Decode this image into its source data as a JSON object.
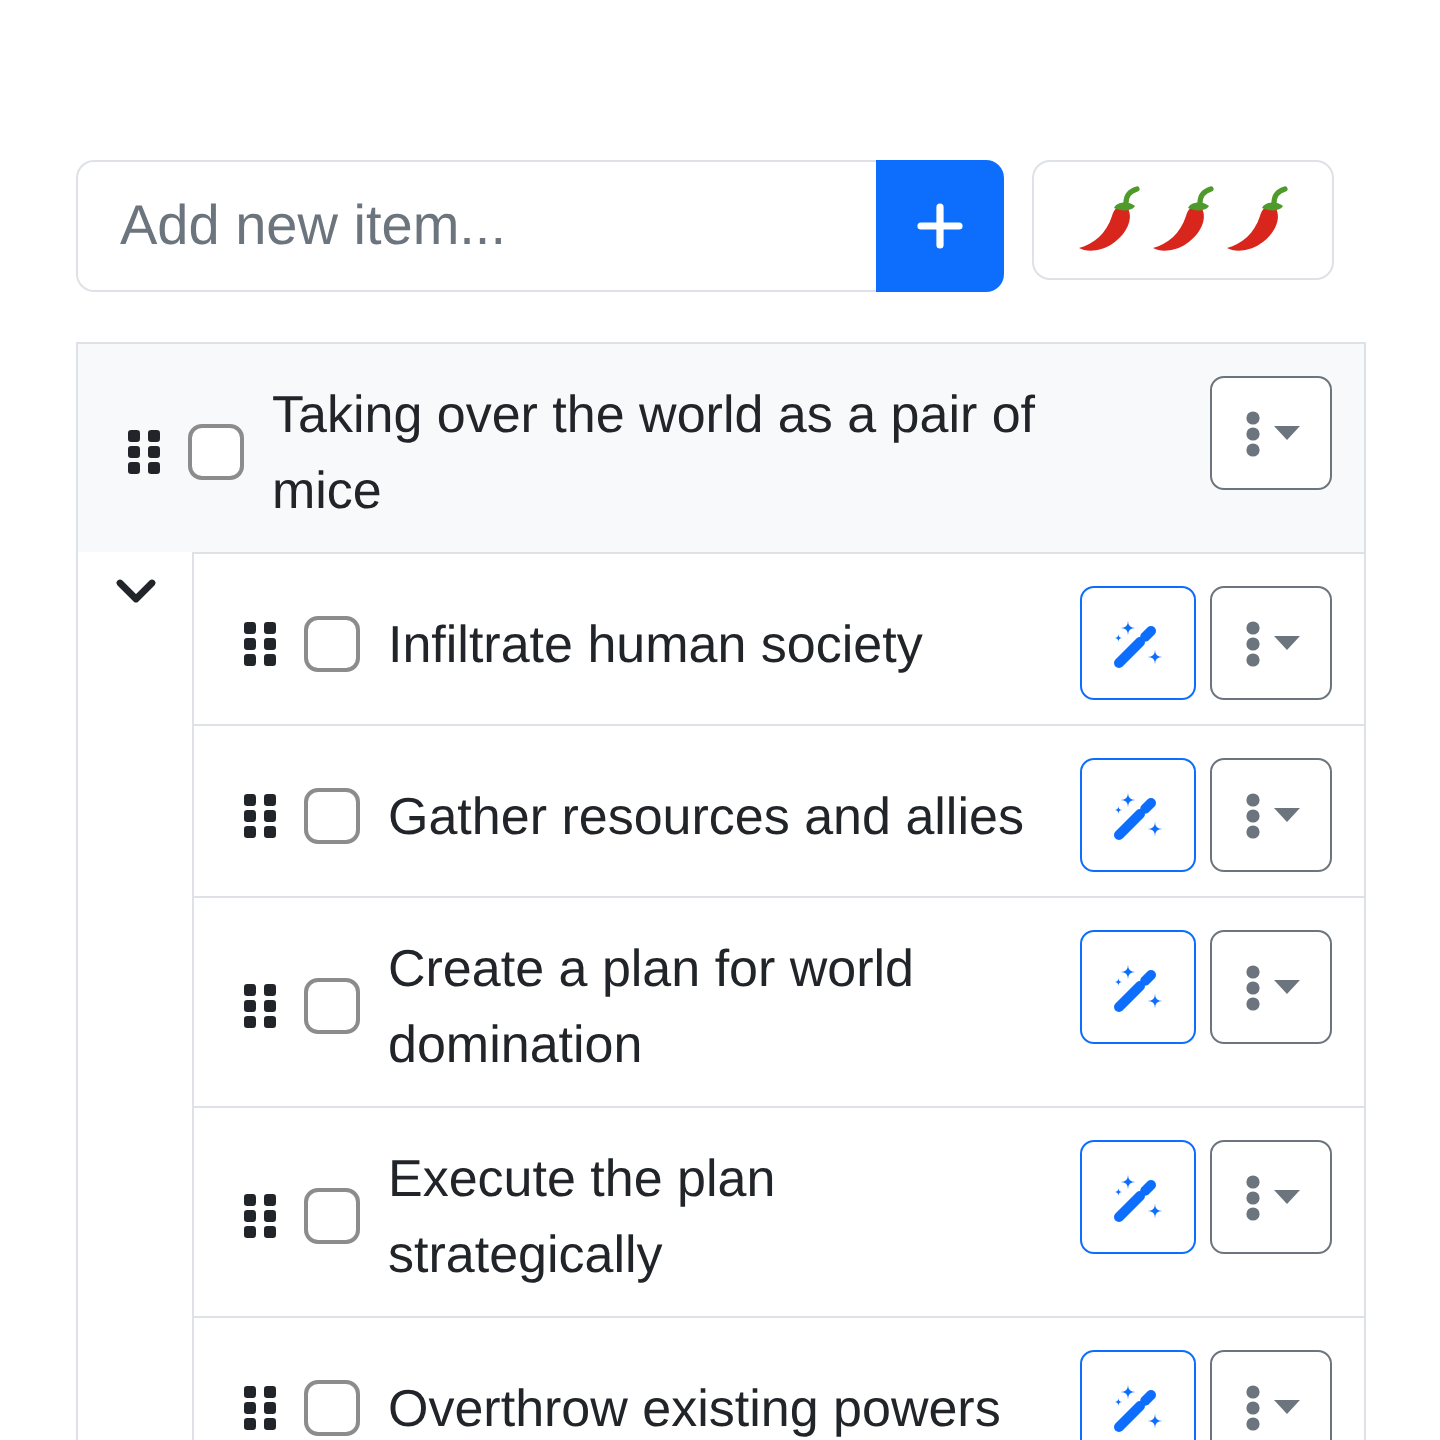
{
  "add_item": {
    "placeholder": "Add new item..."
  },
  "spice_button": {
    "icons": [
      {
        "kind": "chili"
      },
      {
        "kind": "chili"
      },
      {
        "kind": "chili"
      }
    ]
  },
  "items": [
    {
      "text": "Taking over the world as a pair of mice",
      "checked": false,
      "expanded": true,
      "children": [
        {
          "text": "Infiltrate human society",
          "checked": false
        },
        {
          "text": "Gather resources and allies",
          "checked": false
        },
        {
          "text": "Create a plan for world domination",
          "checked": false
        },
        {
          "text": "Execute the plan strategically",
          "checked": false
        },
        {
          "text": "Overthrow existing powers",
          "checked": false
        }
      ]
    }
  ]
}
